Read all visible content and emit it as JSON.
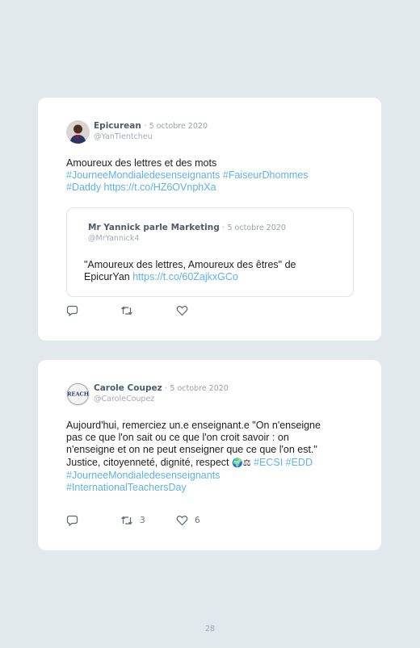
{
  "tweets": [
    {
      "author": "Epicurean",
      "date_sep": "·",
      "date": "5 octobre 2020",
      "handle": "@YanTientcheu",
      "text_lines": [
        {
          "plain": "Amoureux des lettres et des mots",
          "links": ""
        },
        {
          "plain": "",
          "links": "#JourneeMondialedesenseignants #FaiseurDhommes"
        },
        {
          "plain": "",
          "links": "#Daddy https://t.co/HZ6OVnphXa"
        }
      ],
      "quote": {
        "author": "Mr Yannick parle Marketing",
        "date_sep": "·",
        "date": "5 octobre 2020",
        "handle": "@MrYannick4",
        "line1": "\"Amoureux des lettres, Amoureux des êtres\" de",
        "line2_plain": "EpicurYan",
        "line2_link": "https://t.co/60ZajkxGCo"
      },
      "actions": {
        "reply_icon": "reply-icon",
        "retweet_icon": "retweet-icon",
        "like_icon": "heart-icon"
      }
    },
    {
      "author": "Carole Coupez",
      "date_sep": "·",
      "date": "5 octobre 2020",
      "handle": "@CaroleCoupez",
      "avatar_text": "REACH",
      "line1": "Aujourd'hui, remerciez un.e enseignant.e \"On n'enseigne",
      "line2": "pas ce que l'on sait ou ce que l'on croit savoir : on",
      "line3": "n'enseigne et on ne peut enseigner que ce que l'on est.\"",
      "line4_plain": "Justice, citoyenneté, dignité, respect",
      "line4_emoji": "🌍⚖",
      "line4_link": "#ECSI #EDD",
      "line5_link": "#JourneeMondialedesenseignants",
      "line6_link": "#InternationalTeachersDay",
      "actions": {
        "reply_icon": "reply-icon",
        "retweet_icon": "retweet-icon",
        "retweet_count": "3",
        "like_icon": "heart-icon",
        "like_count": "6"
      }
    }
  ],
  "page_number": "28"
}
